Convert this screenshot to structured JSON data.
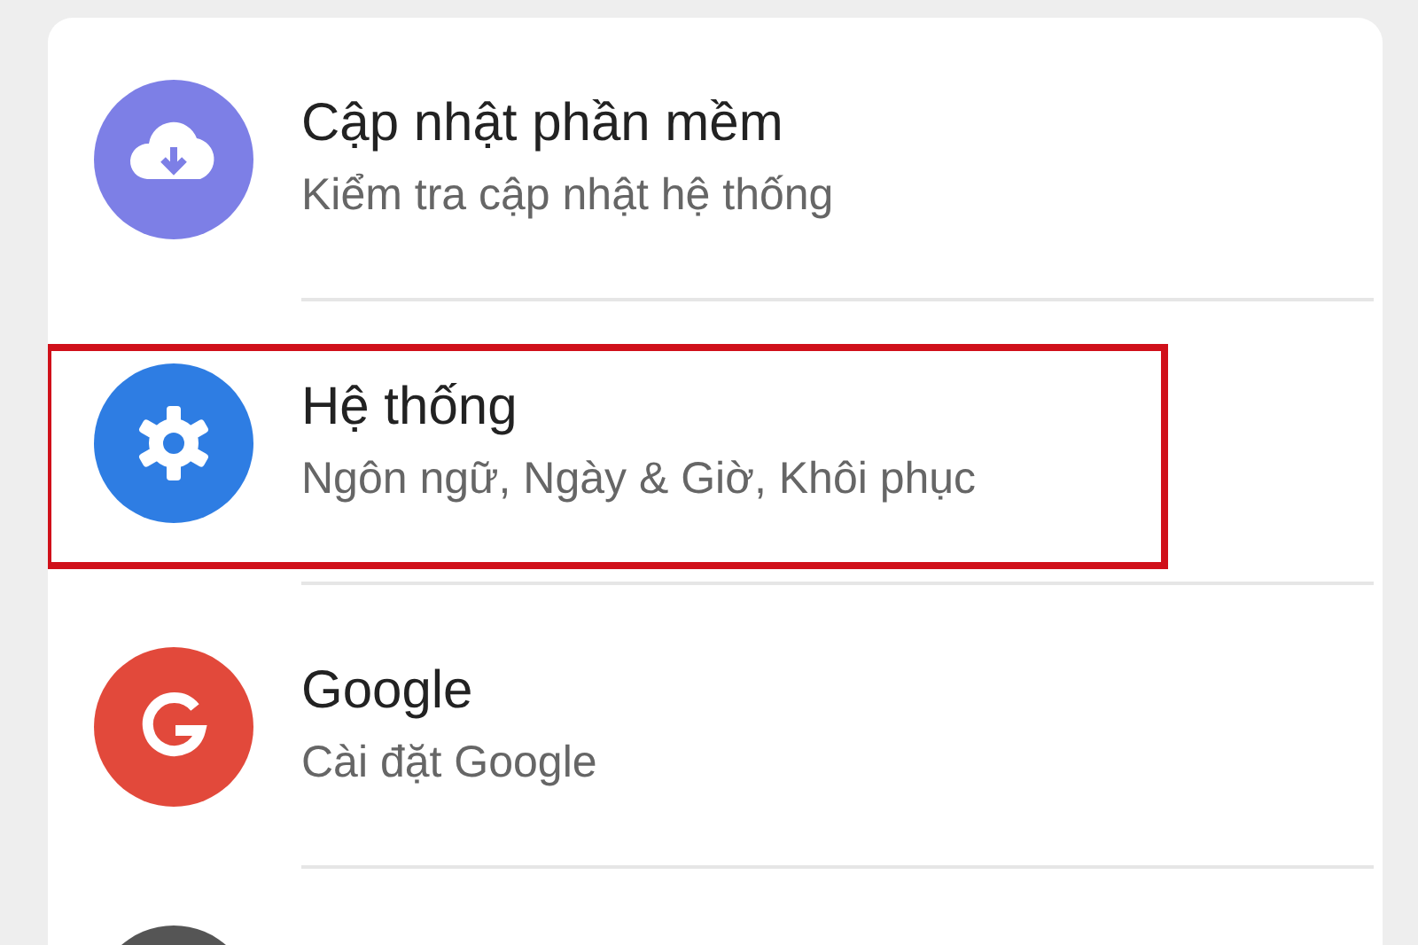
{
  "settings": [
    {
      "kind": "cloud",
      "title": "Cập nhật phần mềm",
      "subtitle": "Kiểm tra cập nhật hệ thống",
      "highlighted": false
    },
    {
      "kind": "gear",
      "title": "Hệ thống",
      "subtitle": "Ngôn ngữ, Ngày & Giờ, Khôi phục",
      "highlighted": true
    },
    {
      "kind": "g",
      "title": "Google",
      "subtitle": "Cài đặt Google",
      "highlighted": false
    },
    {
      "kind": "dark-circle",
      "highlighted": false
    }
  ]
}
